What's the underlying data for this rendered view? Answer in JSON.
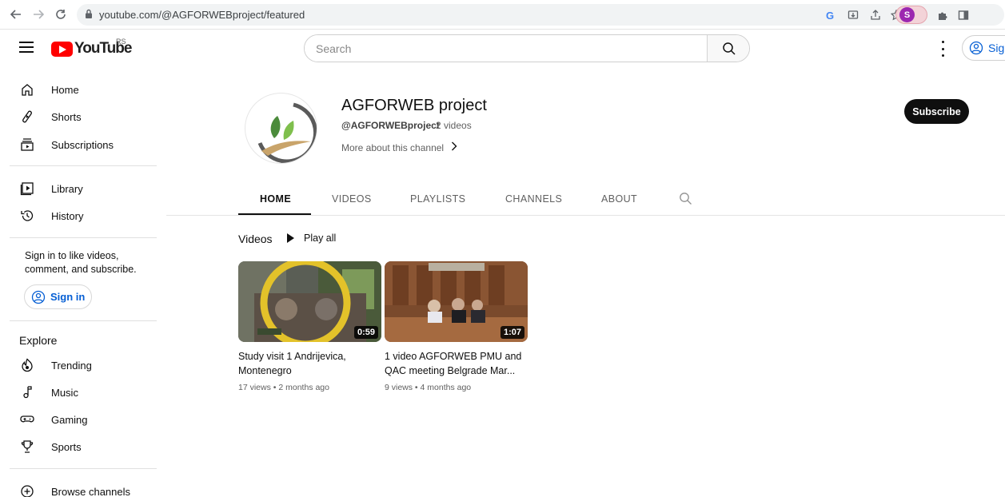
{
  "browser": {
    "url": "youtube.com/@AGFORWEBproject/featured",
    "profile_initial": "S"
  },
  "masthead": {
    "logo_text": "YouTube",
    "region": "RS",
    "search_placeholder": "Search",
    "sign_in_label": "Sig"
  },
  "sidebar": {
    "group1": [
      {
        "label": "Home",
        "icon": "home-icon"
      },
      {
        "label": "Shorts",
        "icon": "shorts-icon"
      },
      {
        "label": "Subscriptions",
        "icon": "subscriptions-icon"
      }
    ],
    "group2": [
      {
        "label": "Library",
        "icon": "library-icon"
      },
      {
        "label": "History",
        "icon": "history-icon"
      }
    ],
    "signin_note": "Sign in to like videos, comment, and subscribe.",
    "signin_button": "Sign in",
    "explore_title": "Explore",
    "explore": [
      {
        "label": "Trending",
        "icon": "trending-icon"
      },
      {
        "label": "Music",
        "icon": "music-icon"
      },
      {
        "label": "Gaming",
        "icon": "gaming-icon"
      },
      {
        "label": "Sports",
        "icon": "sports-icon"
      }
    ],
    "browse_channels": "Browse channels"
  },
  "channel": {
    "name": "AGFORWEB project",
    "handle": "@AGFORWEBproject",
    "video_count": "2 videos",
    "more_about": "More about this channel",
    "subscribe_label": "Subscribe"
  },
  "tabs": [
    {
      "label": "HOME",
      "active": true
    },
    {
      "label": "VIDEOS",
      "active": false
    },
    {
      "label": "PLAYLISTS",
      "active": false
    },
    {
      "label": "CHANNELS",
      "active": false
    },
    {
      "label": "ABOUT",
      "active": false
    }
  ],
  "shelf": {
    "title": "Videos",
    "play_all": "Play all",
    "videos": [
      {
        "title": "Study visit 1 Andrijevica, Montenegro",
        "duration": "0:59",
        "meta": "17 views • 2 months ago"
      },
      {
        "title": "1 video AGFORWEB PMU and QAC meeting Belgrade Mar...",
        "duration": "1:07",
        "meta": "9 views • 4 months ago"
      }
    ]
  },
  "colors": {
    "youtube_red": "#ff0000",
    "link_blue": "#065fd4",
    "subscribe_bg": "#0f0f0f"
  }
}
